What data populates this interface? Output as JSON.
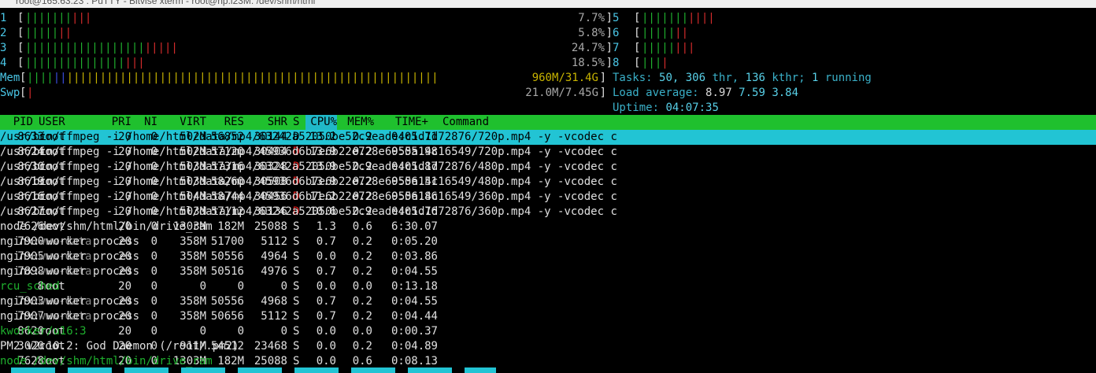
{
  "window": {
    "title": "root@165.63.23 : PuTTY - Bitvise xterm - root@hp.i23M: /dev/shm/html"
  },
  "cpu_meters": [
    {
      "label": "1",
      "percent": 7.7,
      "value": "7.7%",
      "green": 7,
      "red": 3
    },
    {
      "label": "2",
      "percent": 5.8,
      "value": "5.8%",
      "green": 5,
      "red": 2
    },
    {
      "label": "3",
      "percent": 24.7,
      "value": "24.7%",
      "green": 18,
      "red": 5
    },
    {
      "label": "4",
      "percent": 18.5,
      "value": "18.5%",
      "green": 15,
      "red": 3
    },
    {
      "label": "5",
      "percent": 10.0,
      "value": "",
      "green": 7,
      "red": 4
    },
    {
      "label": "6",
      "percent": 7.0,
      "value": "",
      "green": 5,
      "red": 2
    },
    {
      "label": "7",
      "percent": 8.0,
      "value": "",
      "green": 5,
      "red": 3
    },
    {
      "label": "8",
      "percent": 4.0,
      "value": "",
      "green": 3,
      "red": 1
    }
  ],
  "memory": {
    "label": "Mem",
    "value": "960M/31.4G",
    "used_fraction": 0.82
  },
  "swap": {
    "label": "Swp",
    "value": "21.0M/7.45G",
    "used_fraction": 0.003
  },
  "tasks": {
    "label": "Tasks:",
    "total": "50,",
    "threads": "306",
    "thr_label": "thr,",
    "kthreads": "136",
    "kthr_label": "kthr;",
    "running": "1",
    "running_label": "running"
  },
  "load": {
    "label": "Load average:",
    "one": "8.97",
    "five": "7.59",
    "fifteen": "3.84"
  },
  "uptime": {
    "label": "Uptime:",
    "value": "04:07:35"
  },
  "columns": {
    "pid": "PID",
    "user": "USER",
    "pri": "PRI",
    "ni": "NI",
    "virt": "VIRT",
    "res": "RES",
    "shr": "SHR",
    "s": "S",
    "cpu": "CPU%",
    "mem": "MEM%",
    "time": "TIME+",
    "command": "Command"
  },
  "processes": [
    {
      "pid": "8633",
      "user": "root",
      "pri": "20",
      "ni": "0",
      "virt": "502M",
      "res": "56852",
      "shr": "30144",
      "s": "D",
      "cpu": "13.2",
      "mem": "0.2",
      "time": "0:05.71",
      "command": "/usr/bin/ffmpeg -i /home/html/data/mp4/63242a52050be52c9eade4c1d1d72876/720p.mp4 -y -vcodec c",
      "selected": true
    },
    {
      "pid": "8624",
      "user": "root",
      "pri": "20",
      "ni": "0",
      "virt": "502M",
      "res": "57120",
      "shr": "30404",
      "s": "D",
      "cpu": "13.9",
      "mem": "0.2",
      "time": "0:05.98",
      "command": "/usr/bin/ffmpeg -i /home/html/data/mp4/45936d6b7e6b22e728e6955a14c16549/720p.mp4 -y -vcodec c"
    },
    {
      "pid": "8630",
      "user": "root",
      "pri": "20",
      "ni": "0",
      "virt": "503M",
      "res": "57316",
      "shr": "30328",
      "s": "D",
      "cpu": "13.9",
      "mem": "0.2",
      "time": "0:05.87",
      "command": "/usr/bin/ffmpeg -i /home/html/data/mp4/63242a52050be52c9eade4c1d1d72876/480p.mp4 -y -vcodec c"
    },
    {
      "pid": "8619",
      "user": "root",
      "pri": "20",
      "ni": "0",
      "virt": "503M",
      "res": "58260",
      "shr": "30508",
      "s": "D",
      "cpu": "13.9",
      "mem": "0.2",
      "time": "0:06.51",
      "command": "/usr/bin/ffmpeg -i /home/html/data/mp4/45936d6b7e6b22e728e6955a14c16549/480p.mp4 -y -vcodec c"
    },
    {
      "pid": "8616",
      "user": "root",
      "pri": "20",
      "ni": "0",
      "virt": "504M",
      "res": "58744",
      "shr": "30456",
      "s": "D",
      "cpu": "11.2",
      "mem": "0.2",
      "time": "0:06.86",
      "command": "/usr/bin/ffmpeg -i /home/html/data/mp4/45936d6b7e6b22e728e6955a14c16549/360p.mp4 -y -vcodec c"
    },
    {
      "pid": "8627",
      "user": "root",
      "pri": "20",
      "ni": "0",
      "virt": "503M",
      "res": "57112",
      "shr": "30136",
      "s": "D",
      "cpu": "10.6",
      "mem": "0.2",
      "time": "0:05.76",
      "command": "/usr/bin/ffmpeg -i /home/html/data/mp4/63242a52050be52c9eade4c1d1d72876/360p.mp4 -y -vcodec c"
    },
    {
      "pid": "7626",
      "user": "root",
      "pri": "20",
      "ni": "0",
      "virt": "1303M",
      "res": "182M",
      "shr": "25088",
      "s": "S",
      "cpu": "1.3",
      "mem": "0.6",
      "time": "6:30.07",
      "command": "node /dev/shm/html/bin/drive_ram"
    },
    {
      "pid": "7900",
      "user": "www-data",
      "pri": "20",
      "ni": "0",
      "virt": "358M",
      "res": "51700",
      "shr": "5112",
      "s": "S",
      "cpu": "0.7",
      "mem": "0.2",
      "time": "0:05.20",
      "command": "nginx: worker process"
    },
    {
      "pid": "7905",
      "user": "www-data",
      "pri": "20",
      "ni": "0",
      "virt": "358M",
      "res": "50556",
      "shr": "4964",
      "s": "S",
      "cpu": "0.0",
      "mem": "0.2",
      "time": "0:03.86",
      "command": "nginx: worker process"
    },
    {
      "pid": "7898",
      "user": "www-data",
      "pri": "20",
      "ni": "0",
      "virt": "358M",
      "res": "50516",
      "shr": "4976",
      "s": "S",
      "cpu": "0.7",
      "mem": "0.2",
      "time": "0:04.55",
      "command": "nginx: worker process"
    },
    {
      "pid": "8",
      "user": "root",
      "pri": "20",
      "ni": "0",
      "virt": "0",
      "res": "0",
      "shr": "0",
      "s": "S",
      "cpu": "0.0",
      "mem": "0.0",
      "time": "0:13.18",
      "command": "rcu_sched",
      "kernel": true
    },
    {
      "pid": "7903",
      "user": "www-data",
      "pri": "20",
      "ni": "0",
      "virt": "358M",
      "res": "50556",
      "shr": "4968",
      "s": "S",
      "cpu": "0.7",
      "mem": "0.2",
      "time": "0:04.55",
      "command": "nginx: worker process"
    },
    {
      "pid": "7907",
      "user": "www-data",
      "pri": "20",
      "ni": "0",
      "virt": "358M",
      "res": "50656",
      "shr": "5112",
      "s": "S",
      "cpu": "0.7",
      "mem": "0.2",
      "time": "0:04.44",
      "command": "nginx: worker process"
    },
    {
      "pid": "8620",
      "user": "root",
      "pri": "20",
      "ni": "0",
      "virt": "0",
      "res": "0",
      "shr": "0",
      "s": "S",
      "cpu": "0.0",
      "mem": "0.0",
      "time": "0:00.37",
      "command": "kworker/u16:3",
      "kernel": true
    },
    {
      "pid": "3020",
      "user": "root",
      "pri": "20",
      "ni": "0",
      "virt": "911M",
      "res": "54512",
      "shr": "23468",
      "s": "S",
      "cpu": "0.0",
      "mem": "0.2",
      "time": "0:04.89",
      "command": "PM2 v2.10.2: God Daemon (/root/.pm2)"
    },
    {
      "pid": "7628",
      "user": "root",
      "pri": "20",
      "ni": "0",
      "virt": "1303M",
      "res": "182M",
      "shr": "25088",
      "s": "S",
      "cpu": "0.0",
      "mem": "0.6",
      "time": "0:08.13",
      "command": "node /dev/shm/html/bin/drive_ram",
      "thread": true
    }
  ],
  "colors": {
    "header_bg": "#1fc02e",
    "selection": "#22c4d4",
    "meter_label": "#4ac6e6",
    "bar_green": "#1fb02e",
    "bar_red": "#d42b2b",
    "bar_yellow": "#c8b400",
    "bar_blue": "#3a4ee0"
  }
}
